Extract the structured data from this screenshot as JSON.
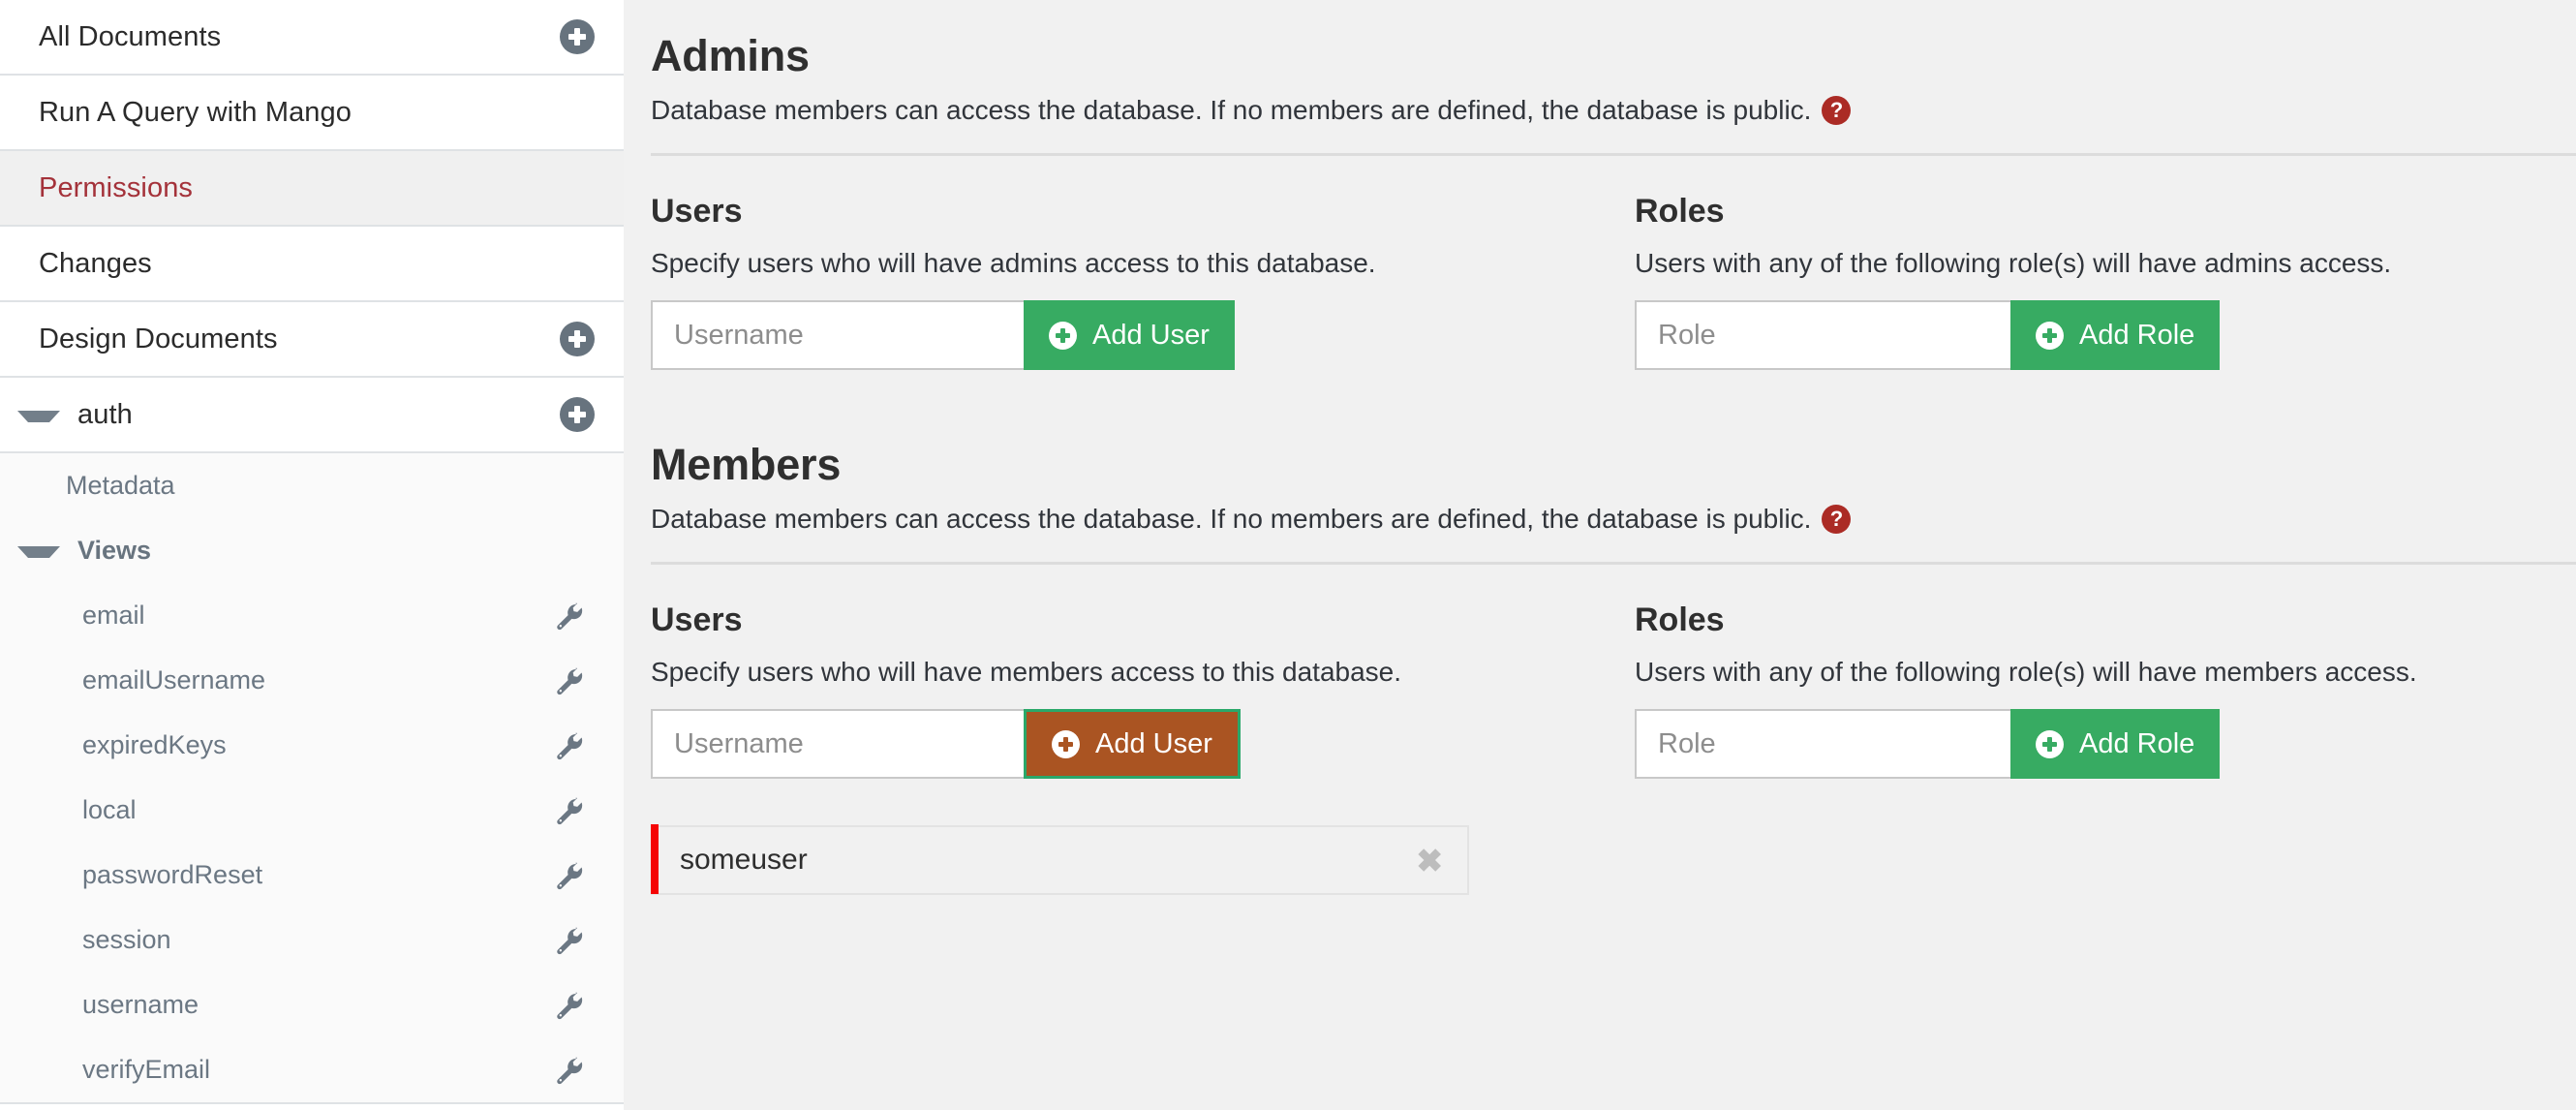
{
  "sidebar": {
    "nav_items": [
      {
        "label": "All Documents",
        "has_plus": true,
        "active": false
      },
      {
        "label": "Run A Query with Mango",
        "has_plus": false,
        "active": false
      },
      {
        "label": "Permissions",
        "has_plus": false,
        "active": true
      },
      {
        "label": "Changes",
        "has_plus": false,
        "active": false
      },
      {
        "label": "Design Documents",
        "has_plus": true,
        "active": false
      }
    ],
    "design_doc": {
      "label": "auth",
      "expanded": true,
      "has_plus": true
    },
    "tree": {
      "metadata_label": "Metadata",
      "views_label": "Views",
      "views_expanded": true,
      "views": [
        {
          "label": "email"
        },
        {
          "label": "emailUsername"
        },
        {
          "label": "expiredKeys"
        },
        {
          "label": "local"
        },
        {
          "label": "passwordReset"
        },
        {
          "label": "session"
        },
        {
          "label": "username"
        },
        {
          "label": "verifyEmail"
        }
      ]
    }
  },
  "main": {
    "admins": {
      "title": "Admins",
      "description": "Database members can access the database. If no members are defined, the database is public.",
      "help_glyph": "?",
      "users": {
        "title": "Users",
        "description": "Specify users who will have admins access to this database.",
        "input_value": "",
        "input_placeholder": "Username",
        "button_label": "Add User"
      },
      "roles": {
        "title": "Roles",
        "description": "Users with any of the following role(s) will have admins access.",
        "input_value": "",
        "input_placeholder": "Role",
        "button_label": "Add Role"
      }
    },
    "members": {
      "title": "Members",
      "description": "Database members can access the database. If no members are defined, the database is public.",
      "help_glyph": "?",
      "users": {
        "title": "Users",
        "description": "Specify users who will have members access to this database.",
        "input_value": "",
        "input_placeholder": "Username",
        "button_label": "Add User",
        "entries": [
          {
            "label": "someuser",
            "close_glyph": "✖"
          }
        ]
      },
      "roles": {
        "title": "Roles",
        "description": "Users with any of the following role(s) will have members access.",
        "input_value": "",
        "input_placeholder": "Role",
        "button_label": "Add Role"
      }
    }
  },
  "colors": {
    "green_button": "#37ab62",
    "brown_button": "#aa5422",
    "green_focus_border": "#2aa86a",
    "active_nav_text": "#a4323a",
    "help_badge": "#ab2b25",
    "entry_accent": "#f50505"
  }
}
